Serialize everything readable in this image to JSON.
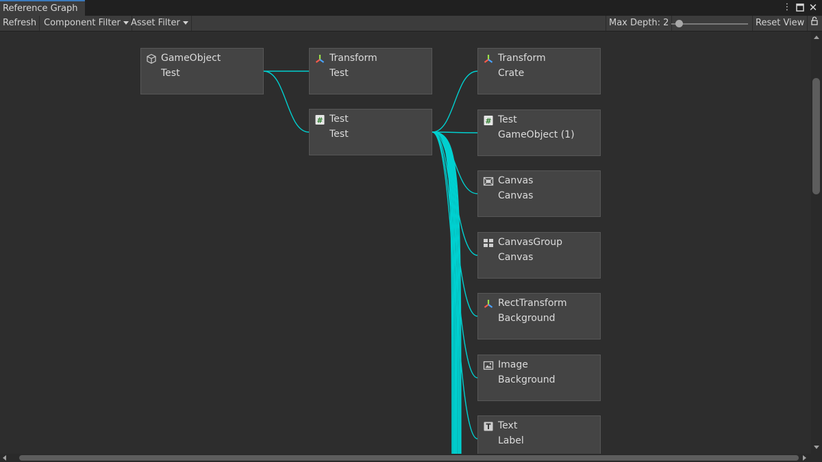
{
  "window": {
    "tab_title": "Reference Graph",
    "menu_icon": "kebab-menu-icon",
    "maximize_icon": "maximize-icon",
    "close_icon": "close-icon",
    "lock_icon": "lock-icon"
  },
  "toolbar": {
    "refresh_label": "Refresh",
    "component_filter_label": "Component Filter",
    "asset_filter_label": "Asset Filter",
    "max_depth_label": "Max Depth: 2",
    "max_depth_value": 2,
    "max_depth_slider_fraction": 0.1,
    "reset_view_label": "Reset View"
  },
  "colors": {
    "edge": "#00d0d0",
    "accent_tab": "#3a79bb"
  },
  "graph": {
    "root": {
      "type": "GameObject",
      "name": "Test",
      "icon": "cube-icon"
    },
    "level1": [
      {
        "type": "Transform",
        "name": "Test",
        "icon": "transform-icon"
      },
      {
        "type": "Test",
        "name": "Test",
        "icon": "script-icon"
      }
    ],
    "level2": [
      {
        "type": "Transform",
        "name": "Crate",
        "icon": "transform-icon"
      },
      {
        "type": "Test",
        "name": "GameObject (1)",
        "icon": "script-icon"
      },
      {
        "type": "Canvas",
        "name": "Canvas",
        "icon": "canvas-icon"
      },
      {
        "type": "CanvasGroup",
        "name": "Canvas",
        "icon": "canvas-group-icon"
      },
      {
        "type": "RectTransform",
        "name": "Background",
        "icon": "transform-icon"
      },
      {
        "type": "Image",
        "name": "Background",
        "icon": "image-icon"
      },
      {
        "type": "Text",
        "name": "Label",
        "icon": "text-icon"
      }
    ]
  }
}
